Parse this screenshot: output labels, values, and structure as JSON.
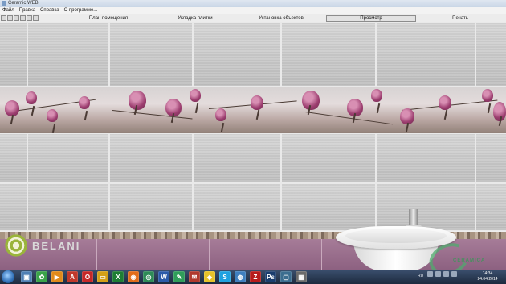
{
  "window": {
    "title": "Ceramic WEB"
  },
  "menu": [
    "Файл",
    "Правка",
    "Справка",
    "О программе..."
  ],
  "tabs": [
    {
      "label": "План помещения",
      "active": false
    },
    {
      "label": "Укладка плитки",
      "active": false
    },
    {
      "label": "Установка объектов",
      "active": false
    },
    {
      "label": "Просмотр",
      "active": true
    },
    {
      "label": "Печать",
      "active": false
    }
  ],
  "toolbar_icons": [
    "new-icon",
    "open-icon",
    "save-icon",
    "undo-icon",
    "redo-icon",
    "zoom-icon"
  ],
  "brand": {
    "logo_text": "BELANI",
    "watermark_text": "CERAMICA"
  },
  "taskbar": {
    "apps": [
      {
        "name": "explorer-icon",
        "color": "#4f7fb3",
        "glyph": "▣"
      },
      {
        "name": "network-icon",
        "color": "#3aa34a",
        "glyph": "✿"
      },
      {
        "name": "media-player-icon",
        "color": "#e08a1a",
        "glyph": "▶"
      },
      {
        "name": "pdf-icon",
        "color": "#c0392b",
        "glyph": "A"
      },
      {
        "name": "opera-icon",
        "color": "#c62828",
        "glyph": "O"
      },
      {
        "name": "folder-icon",
        "color": "#d4a017",
        "glyph": "▭"
      },
      {
        "name": "excel-icon",
        "color": "#1e7e34",
        "glyph": "X"
      },
      {
        "name": "firefox-icon",
        "color": "#e06c1a",
        "glyph": "◉"
      },
      {
        "name": "chrome-icon",
        "color": "#2e8b57",
        "glyph": "◎"
      },
      {
        "name": "word-icon",
        "color": "#2b5aa8",
        "glyph": "W"
      },
      {
        "name": "corel-icon",
        "color": "#2f9d5a",
        "glyph": "✎"
      },
      {
        "name": "mail-icon",
        "color": "#b03a2e",
        "glyph": "✉"
      },
      {
        "name": "batman-icon",
        "color": "#e6c229",
        "glyph": "◆"
      },
      {
        "name": "skype-icon",
        "color": "#1ea1e0",
        "glyph": "S"
      },
      {
        "name": "earth-icon",
        "color": "#3f7fbf",
        "glyph": "◍"
      },
      {
        "name": "filezilla-icon",
        "color": "#b71c1c",
        "glyph": "Z"
      },
      {
        "name": "photoshop-icon",
        "color": "#1b3d6e",
        "glyph": "Ps"
      },
      {
        "name": "monitor-icon",
        "color": "#3b6d8f",
        "glyph": "▢"
      },
      {
        "name": "ceramic-app-icon",
        "color": "#6b6b6b",
        "glyph": "▦"
      }
    ],
    "lang": "RU",
    "time": "14:34",
    "date": "24.04.2014"
  }
}
